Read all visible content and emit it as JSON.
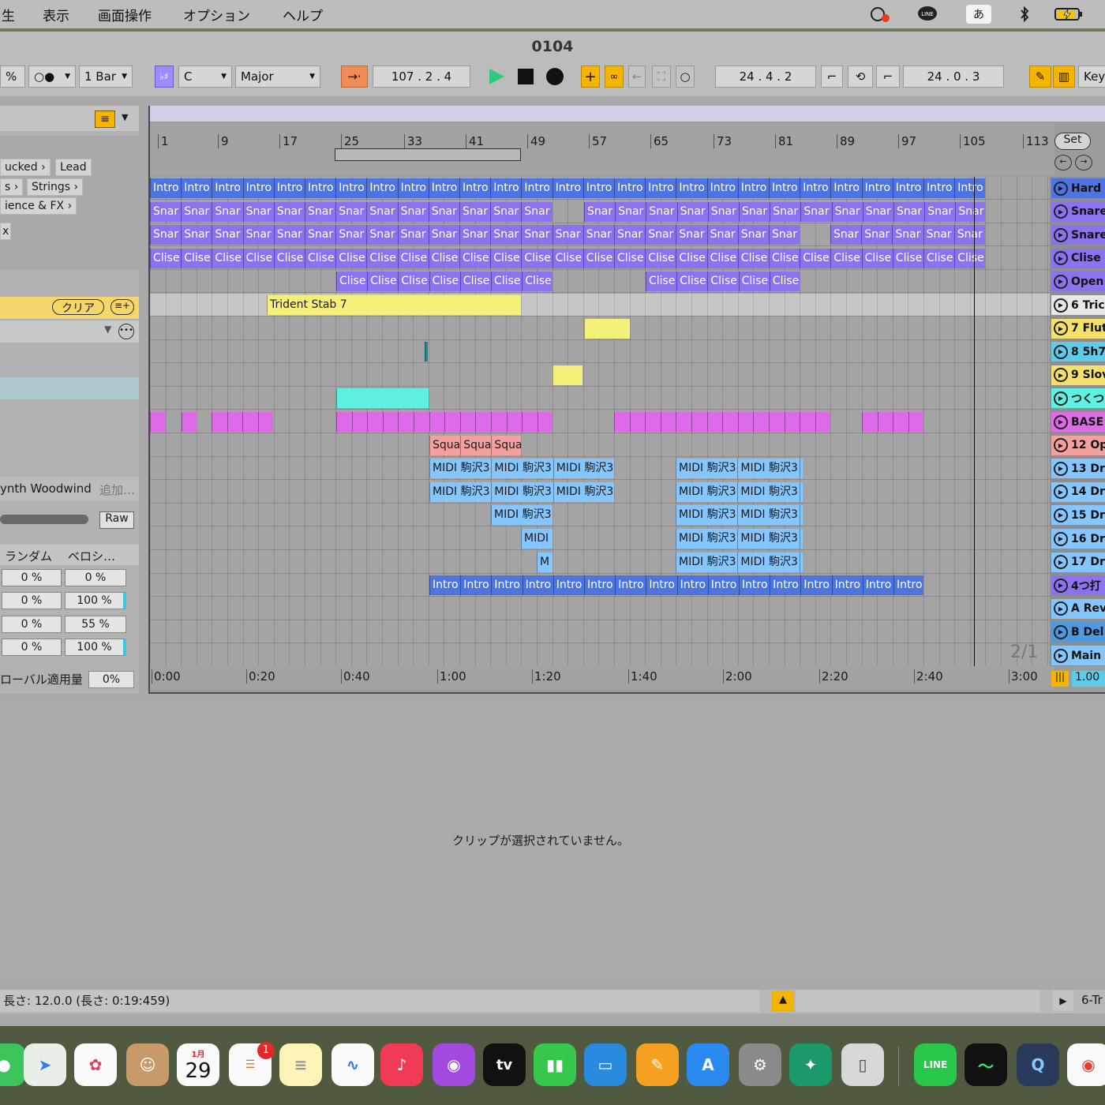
{
  "menubar": {
    "items": [
      "生",
      "表示",
      "画面操作",
      "オプション",
      "ヘルプ"
    ],
    "input_method": "あ",
    "line_label": "LINE"
  },
  "window": {
    "title": "0104"
  },
  "control_bar": {
    "zoom": "%",
    "record_mode": "○●",
    "quantize": "1 Bar",
    "scale_root": "C",
    "scale_mode": "Major",
    "position": "107 .   2 .   4",
    "loop_start": "24 .   4 .   2",
    "loop_length": "24 .   0 .   3",
    "key_label": "Key"
  },
  "left_panel": {
    "browser_items": [
      "ucked",
      "Lead",
      "s",
      "Strings",
      "ience & FX",
      "x"
    ],
    "clear_label": "クリア",
    "device_name": "ynth Woodwind",
    "add_label": "追加…",
    "raw_label": "Raw",
    "random_label": "ランダム",
    "velocity_label": "ベロシ…",
    "rows": [
      [
        "0 %",
        "0 %"
      ],
      [
        "0 %",
        "100 %"
      ],
      [
        "0 %",
        "55 %"
      ],
      [
        "0 %",
        "100 %"
      ]
    ],
    "global_label": "ローバル適用量",
    "global_value": "0%"
  },
  "ruler": {
    "bars": [
      "1",
      "9",
      "17",
      "25",
      "33",
      "41",
      "49",
      "57",
      "65",
      "73",
      "81",
      "89",
      "97",
      "105",
      "113"
    ],
    "set_label": "Set"
  },
  "timeline": {
    "times": [
      "0:00",
      "0:20",
      "0:40",
      "1:00",
      "1:20",
      "1:40",
      "2:00",
      "2:20",
      "2:40",
      "3:00"
    ],
    "signature": "2/1",
    "tempo_ratio": "1.00"
  },
  "tracks": [
    "Hard",
    "Snare",
    "Snare",
    "Clise",
    "Open",
    "6 Tric",
    "7 Flut",
    "8 5h7",
    "9 Slov",
    "つくつ",
    "BASE",
    "12 Op",
    "13 Dr",
    "14 Dr",
    "15 Dr",
    "16 Dr",
    "17 Dr",
    "4つ打",
    "A Rev",
    "B Del",
    "Main"
  ],
  "clip_labels": {
    "intro": "Intro",
    "snare": "Snar",
    "clise": "Clise",
    "trident": "Trident Stab 7",
    "square": "Squa",
    "midi": "MIDI 駒沢3",
    "midi_short": "MIDI",
    "m": "M"
  },
  "detail": {
    "empty_message": "クリップが選択されていません。"
  },
  "status": {
    "length": "長さ: 12.0.0  (長さ: 0:19:459)",
    "right": "6-Tr"
  },
  "dock": {
    "calendar_month": "1月",
    "calendar_day": "29",
    "badge": "1"
  },
  "colors": {
    "blue_clip": "#4d74e0",
    "purple_clip": "#8d72f0",
    "yellow_clip": "#f5f07a",
    "cyan_clip": "#5ef0e0",
    "magenta_clip": "#dd6ae6",
    "salmon_clip": "#f5a0a0",
    "lightblue_clip": "#86c6ff",
    "play_green": "#2ec97a",
    "accent_orange": "#f5b400"
  }
}
